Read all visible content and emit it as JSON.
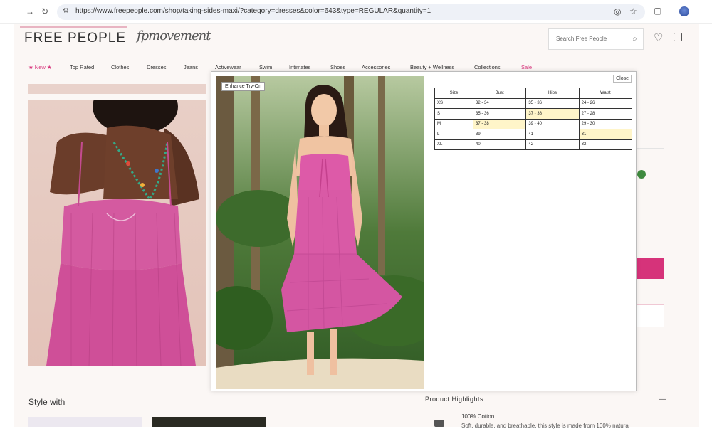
{
  "browser": {
    "url": "https://www.freepeople.com/shop/taking-sides-maxi/?category=dresses&color=643&type=REGULAR&quantity=1"
  },
  "header": {
    "logo": "FREE PEOPLE",
    "sub_brand": "fpmovement",
    "search_placeholder": "Search Free People"
  },
  "nav": {
    "items": [
      "★ New ★",
      "Top Rated",
      "Clothes",
      "Dresses",
      "Jeans",
      "Activewear",
      "Swim",
      "Intimates",
      "Shoes",
      "Accessories",
      "Beauty + Wellness",
      "Collections",
      "Sale"
    ],
    "accent": "#d6337a"
  },
  "product": {
    "style_with": "Style with",
    "highlights_title": "Product Highlights",
    "highlight_name": "100% Cotton",
    "highlight_desc": "Soft, durable, and breathable, this style is made from 100% natural"
  },
  "tryon": {
    "enhance_label": "Enhance Try-On",
    "close_label": "Close",
    "size_table": {
      "headers": [
        "Size",
        "Bust",
        "Hips",
        "Waist"
      ],
      "rows": [
        [
          "XS",
          "32 - 34",
          "35 - 36",
          "24 - 26"
        ],
        [
          "S",
          "35 - 36",
          "37 - 38",
          "27 - 28"
        ],
        [
          "M",
          "37 - 38",
          "39 - 40",
          "29 - 30"
        ],
        [
          "L",
          "39",
          "41",
          "31"
        ],
        [
          "XL",
          "40",
          "42",
          "32"
        ]
      ],
      "highlighted": [
        [
          1,
          2
        ],
        [
          2,
          1
        ],
        [
          3,
          3
        ]
      ],
      "highlight_color": "#fff5c9"
    }
  }
}
